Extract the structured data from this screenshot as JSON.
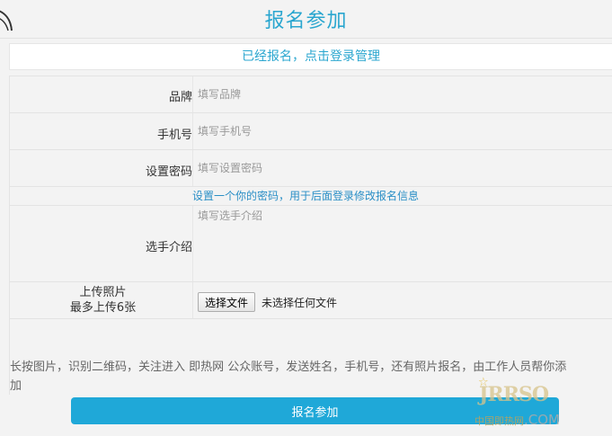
{
  "header": {
    "title": "报名参加",
    "back_icon": "back-arrow-icon"
  },
  "login_banner": {
    "text": "已经报名，点击登录管理"
  },
  "form": {
    "brand": {
      "label": "品牌",
      "placeholder": "填写品牌",
      "value": ""
    },
    "phone": {
      "label": "手机号",
      "placeholder": "填写手机号",
      "value": ""
    },
    "password": {
      "label": "设置密码",
      "placeholder": "填写设置密码",
      "value": "",
      "hint": "设置一个你的密码，用于后面登录修改报名信息"
    },
    "intro": {
      "label": "选手介绍",
      "placeholder": "填写选手介绍",
      "value": ""
    },
    "photo": {
      "label_line1": "上传照片",
      "label_line2": "最多上传6张",
      "button_label": "选择文件",
      "status": "未选择任何文件"
    }
  },
  "notice": {
    "line1": "长按图片，识别二维码，关注进入 即热网   公众账号，发送姓名，手机号，还有照片报名，由工作人员帮你添",
    "line2": "加"
  },
  "submit_label": "报名参加",
  "watermark": {
    "top": "JRRSO",
    "bottom_left": "中国即热网",
    "bottom_right": ".COM"
  },
  "colors": {
    "accent": "#2aa6cf",
    "submit_bg": "#1fa8d8",
    "hint": "#2a8fc6",
    "background": "#f3f3f3"
  }
}
